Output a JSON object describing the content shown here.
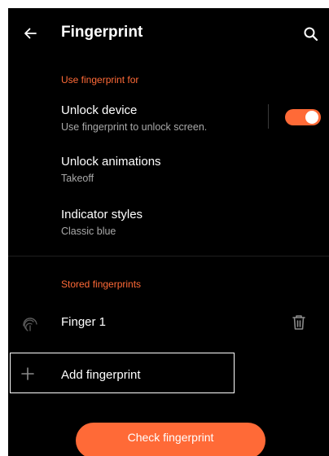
{
  "header": {
    "title": "Fingerprint",
    "back_icon": "arrow-left-icon",
    "search_icon": "search-icon"
  },
  "use_section": {
    "header": "Use fingerprint for",
    "items": [
      {
        "title": "Unlock device",
        "subtitle": "Use fingerprint to unlock screen.",
        "toggle_on": true
      },
      {
        "title": "Unlock animations",
        "subtitle": "Takeoff"
      },
      {
        "title": "Indicator styles",
        "subtitle": "Classic blue"
      }
    ]
  },
  "stored_section": {
    "header": "Stored fingerprints",
    "fingerprints": [
      {
        "name": "Finger 1",
        "icon": "fingerprint-icon",
        "delete_icon": "trash-icon"
      }
    ],
    "add_label": "Add fingerprint",
    "add_icon": "plus-icon"
  },
  "check_button": {
    "label": "Check fingerprint"
  },
  "colors": {
    "accent": "#ff6a37",
    "background": "#000000",
    "text_primary": "#ffffff",
    "text_secondary": "#a9a9a9"
  }
}
